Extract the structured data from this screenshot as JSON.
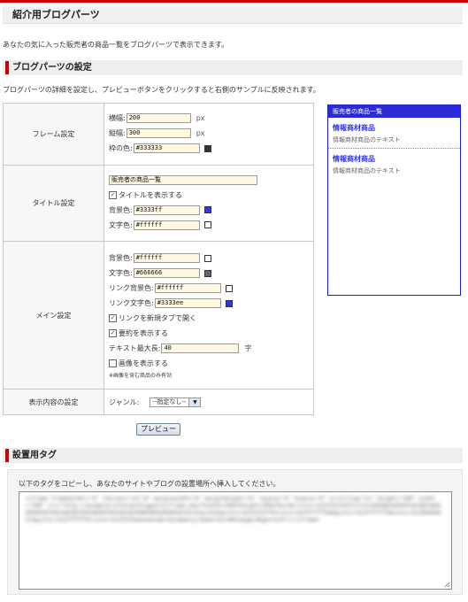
{
  "page": {
    "title": "紹介用ブログパーツ",
    "intro": "あなたの気に入った販売者の商品一覧をブログパーツで表示できます。"
  },
  "settings_section": {
    "heading": "ブログパーツの設定",
    "description": "ブログパーツの詳細を設定し、プレビューボタンをクリックすると右側のサンプルに反映されます。"
  },
  "frame": {
    "label": "フレーム設定",
    "width_label": "横幅:",
    "width_value": "200",
    "width_unit": "px",
    "height_label": "縦幅:",
    "height_value": "300",
    "height_unit": "px",
    "border_label": "枠の色:",
    "border_value": "#333333"
  },
  "title_settings": {
    "label": "タイトル設定",
    "title_value": "販売者の商品一覧",
    "show_title_label": "タイトルを表示する",
    "bg_label": "背景色:",
    "bg_value": "#3333ff",
    "text_label": "文字色:",
    "text_value": "#ffffff"
  },
  "main_settings": {
    "label": "メイン設定",
    "bg_label": "背景色:",
    "bg_value": "#ffffff",
    "text_label": "文字色:",
    "text_value": "#666666",
    "link_bg_label": "リンク背景色:",
    "link_bg_value": "#ffffff",
    "link_text_label": "リンク文字色:",
    "link_text_value": "#3333ee",
    "new_tab_label": "リンクを新規タブで開く",
    "summary_label": "要約を表示する",
    "max_len_label": "テキスト最大長:",
    "max_len_value": "40",
    "max_len_unit": "字",
    "show_image_label": "画像を表示する",
    "image_note": "※画像を含む商品のみ有効"
  },
  "display_settings": {
    "label": "表示内容の設定",
    "genre_label": "ジャンル:",
    "genre_selected": "--指定なし--"
  },
  "preview_button": "プレビュー",
  "preview": {
    "header": "販売者の商品一覧",
    "items": [
      {
        "title": "情報商材商品",
        "text": "情報商材商品のテキスト"
      },
      {
        "title": "情報商材商品",
        "text": "情報商材商品のテキスト"
      }
    ]
  },
  "tag_section": {
    "heading": "設置用タグ",
    "instruction": "以下のタグをコピーし、あなたのサイトやブログの設置場所へ挿入してください。",
    "code": "<iframe frameborder=\"0\" charset=\"utf-8\" marginwidth=\"0\" marginheight=\"0\" vspace=\"0\" hspace=\"0\" scrolling=\"no\" height=\"300\" width=\"200\" src=\"http://example/infotop/blogparts/frame.php?fwidth=200&fheight=300&fbordercolor=%23333333&ftitle=%E8%B2%A9%E5%A3%B2%E8%80%85%E3%81%AE%E5%95%86%E5%93%81%E4%B8%80%E8%A6%A7&tshow=1&tbgcolor=%233333ff&tcolor=%23ffffff&mbgcolor=%23ffffff&mcolor=%23666666&lbgcolor=%23ffffff&lcolor=%233333ee&newtab=1&summary=1&maxlen=40&image=0&genre=0\"></iframe>"
  },
  "colors": {
    "accent": "#cc0000",
    "swatch_border": "#333333",
    "swatch_title_bg": "#3333ff",
    "swatch_title_text": "#ffffff",
    "swatch_main_bg": "#ffffff",
    "swatch_main_text": "#666666",
    "swatch_link_bg": "#ffffff",
    "swatch_link_text": "#3333ee"
  }
}
